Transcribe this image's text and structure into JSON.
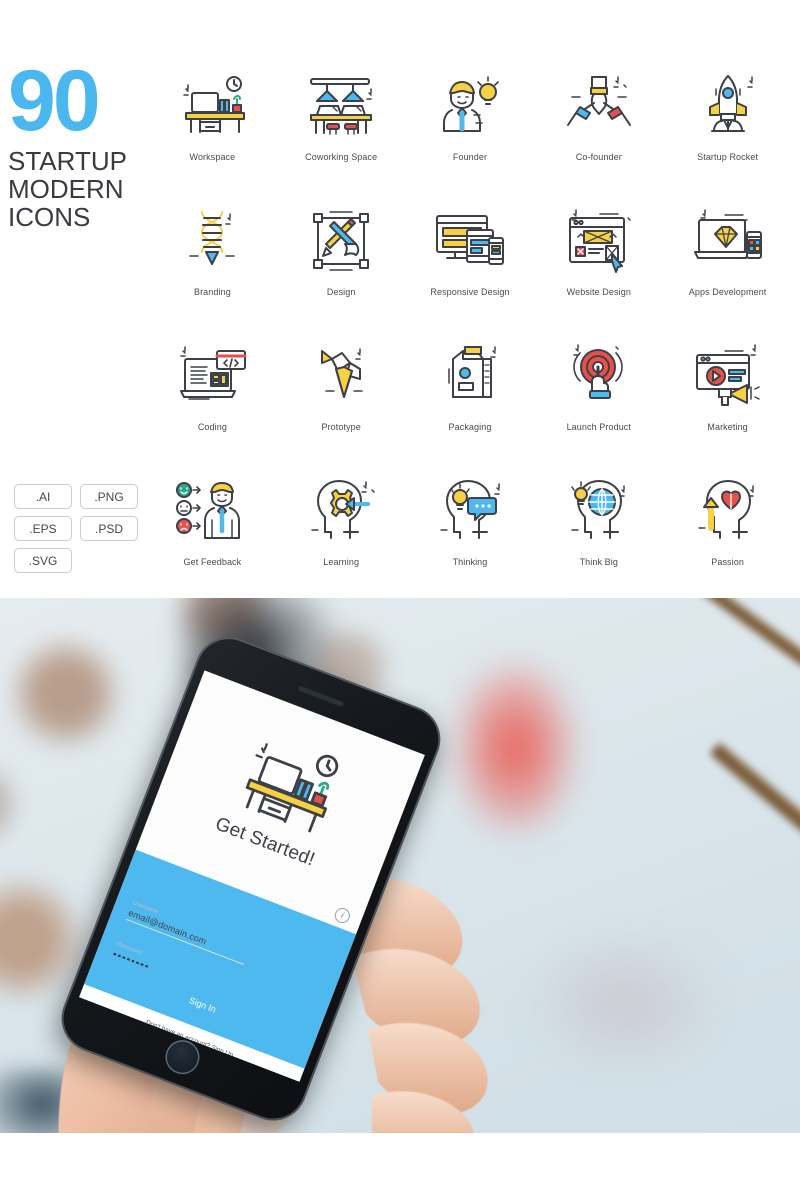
{
  "header": {
    "count": "90",
    "subtitle_lines": [
      "STARTUP",
      "MODERN",
      "ICONS"
    ],
    "accent_color": "#4ab8ef",
    "text_color": "#3a3a40"
  },
  "formats": {
    "rows": [
      [
        "​.AI",
        "​.PNG"
      ],
      [
        "​.EPS",
        "​.PSD"
      ],
      [
        "​.SVG"
      ]
    ],
    "items": [
      ".AI",
      ".PNG",
      ".EPS",
      ".PSD",
      ".SVG"
    ]
  },
  "icons": [
    {
      "id": "workspace",
      "label": "Workspace"
    },
    {
      "id": "coworking-space",
      "label": "Coworking Space"
    },
    {
      "id": "founder",
      "label": "Founder"
    },
    {
      "id": "co-founder",
      "label": "Co-founder"
    },
    {
      "id": "startup-rocket",
      "label": "Startup Rocket"
    },
    {
      "id": "branding",
      "label": "Branding"
    },
    {
      "id": "design",
      "label": "Design"
    },
    {
      "id": "responsive-design",
      "label": "Responsive Design"
    },
    {
      "id": "website-design",
      "label": "Website Design"
    },
    {
      "id": "apps-development",
      "label": "Apps Development"
    },
    {
      "id": "coding",
      "label": "Coding"
    },
    {
      "id": "prototype",
      "label": "Prototype"
    },
    {
      "id": "packaging",
      "label": "Packaging"
    },
    {
      "id": "launch-product",
      "label": "Launch Product"
    },
    {
      "id": "marketing",
      "label": "Marketing"
    },
    {
      "id": "get-feedback",
      "label": "Get Feedback"
    },
    {
      "id": "learning",
      "label": "Learning"
    },
    {
      "id": "thinking",
      "label": "Thinking"
    },
    {
      "id": "think-big",
      "label": "Think Big"
    },
    {
      "id": "passion",
      "label": "Passion"
    }
  ],
  "palette": {
    "line": "#3d4147",
    "yellow": "#f7d044",
    "blue": "#4eb9ef",
    "red": "#e8514b",
    "teal": "#2aa98a",
    "accent_blue": "#4ab8ef"
  },
  "mockup": {
    "scene": "hand-holding-phone-on-desk",
    "app": {
      "title": "Get Started!",
      "info_glyph": "i",
      "username": {
        "label": "Username",
        "value": "email@domain.com"
      },
      "password": {
        "label": "Password",
        "value": "••••••••"
      },
      "sign_in_label": "Sign In",
      "sign_up_prompt": "Don't have an account? Sign Up",
      "button_color": "#4eb9ef"
    }
  }
}
